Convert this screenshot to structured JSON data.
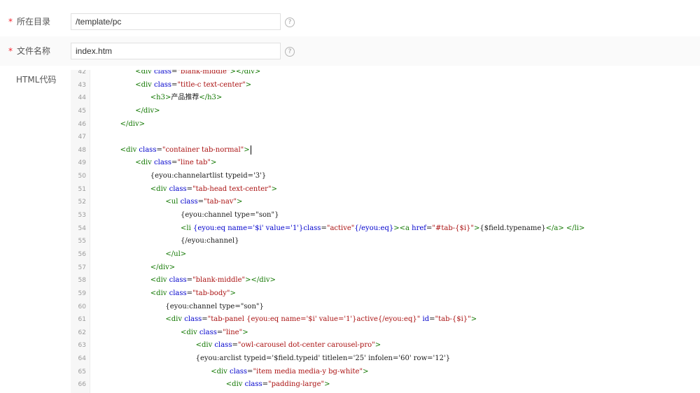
{
  "fields": {
    "directory": {
      "required": "*",
      "label": "所在目录",
      "value": "/template/pc"
    },
    "filename": {
      "required": "*",
      "label": "文件名称",
      "value": "index.htm"
    },
    "html_code": {
      "label": "HTML代码"
    }
  },
  "help_glyph": "?",
  "editor": {
    "lines": [
      {
        "n": "42",
        "indent": 2,
        "parts": [
          [
            "t",
            "<div"
          ],
          [
            "p",
            " "
          ],
          [
            "a",
            "class"
          ],
          [
            "p",
            "="
          ],
          [
            "s",
            "\"blank-middle\""
          ],
          [
            "t",
            "></div>"
          ]
        ]
      },
      {
        "n": "43",
        "indent": 2,
        "parts": [
          [
            "t",
            "<div"
          ],
          [
            "p",
            " "
          ],
          [
            "a",
            "class"
          ],
          [
            "p",
            "="
          ],
          [
            "s",
            "\"title-c text-center\""
          ],
          [
            "t",
            ">"
          ]
        ]
      },
      {
        "n": "44",
        "indent": 3,
        "parts": [
          [
            "t",
            "<h3>"
          ],
          [
            "p",
            "产品推荐"
          ],
          [
            "t",
            "</h3>"
          ]
        ]
      },
      {
        "n": "45",
        "indent": 2,
        "parts": [
          [
            "t",
            "</div>"
          ]
        ]
      },
      {
        "n": "46",
        "indent": 1,
        "parts": [
          [
            "t",
            "</div>"
          ]
        ]
      },
      {
        "n": "47",
        "indent": 0,
        "parts": []
      },
      {
        "n": "48",
        "indent": 1,
        "cursor": true,
        "parts": [
          [
            "t",
            "<div"
          ],
          [
            "p",
            " "
          ],
          [
            "a",
            "class"
          ],
          [
            "p",
            "="
          ],
          [
            "s",
            "\"container tab-normal\""
          ],
          [
            "t",
            ">"
          ]
        ]
      },
      {
        "n": "49",
        "indent": 2,
        "parts": [
          [
            "t",
            "<div"
          ],
          [
            "p",
            " "
          ],
          [
            "a",
            "class"
          ],
          [
            "p",
            "="
          ],
          [
            "s",
            "\"line tab\""
          ],
          [
            "t",
            ">"
          ]
        ]
      },
      {
        "n": "50",
        "indent": 3,
        "parts": [
          [
            "p",
            "{eyou:channelartlist typeid='3'}"
          ]
        ]
      },
      {
        "n": "51",
        "indent": 3,
        "parts": [
          [
            "t",
            "<div"
          ],
          [
            "p",
            " "
          ],
          [
            "a",
            "class"
          ],
          [
            "p",
            "="
          ],
          [
            "s",
            "\"tab-head text-center\""
          ],
          [
            "t",
            ">"
          ]
        ]
      },
      {
        "n": "52",
        "indent": 4,
        "parts": [
          [
            "t",
            "<ul"
          ],
          [
            "p",
            " "
          ],
          [
            "a",
            "class"
          ],
          [
            "p",
            "="
          ],
          [
            "s",
            "\"tab-nav\""
          ],
          [
            "t",
            ">"
          ]
        ]
      },
      {
        "n": "53",
        "indent": 5,
        "parts": [
          [
            "p",
            "{eyou:channel type=\"son\"}"
          ]
        ]
      },
      {
        "n": "54",
        "indent": 5,
        "parts": [
          [
            "t",
            "<li"
          ],
          [
            "p",
            " "
          ],
          [
            "a",
            "{eyou:eq name='$i' value='1'}class"
          ],
          [
            "p",
            "="
          ],
          [
            "s",
            "\"active\""
          ],
          [
            "a",
            "{/eyou:eq}"
          ],
          [
            "t",
            ">"
          ],
          [
            "t",
            "<a"
          ],
          [
            "p",
            " "
          ],
          [
            "a",
            "href"
          ],
          [
            "p",
            "="
          ],
          [
            "s",
            "\"#tab-{$i}\""
          ],
          [
            "t",
            ">"
          ],
          [
            "p",
            "{$field.typename}"
          ],
          [
            "t",
            "</a>"
          ],
          [
            "p",
            " "
          ],
          [
            "t",
            "</li>"
          ]
        ]
      },
      {
        "n": "55",
        "indent": 5,
        "parts": [
          [
            "p",
            "{/eyou:channel}"
          ]
        ]
      },
      {
        "n": "56",
        "indent": 4,
        "parts": [
          [
            "t",
            "</ul>"
          ]
        ]
      },
      {
        "n": "57",
        "indent": 3,
        "parts": [
          [
            "t",
            "</div>"
          ]
        ]
      },
      {
        "n": "58",
        "indent": 3,
        "parts": [
          [
            "t",
            "<div"
          ],
          [
            "p",
            " "
          ],
          [
            "a",
            "class"
          ],
          [
            "p",
            "="
          ],
          [
            "s",
            "\"blank-middle\""
          ],
          [
            "t",
            "></div>"
          ]
        ]
      },
      {
        "n": "59",
        "indent": 3,
        "parts": [
          [
            "t",
            "<div"
          ],
          [
            "p",
            " "
          ],
          [
            "a",
            "class"
          ],
          [
            "p",
            "="
          ],
          [
            "s",
            "\"tab-body\""
          ],
          [
            "t",
            ">"
          ]
        ]
      },
      {
        "n": "60",
        "indent": 4,
        "parts": [
          [
            "p",
            "{eyou:channel type=\"son\"}"
          ]
        ]
      },
      {
        "n": "61",
        "indent": 4,
        "parts": [
          [
            "t",
            "<div"
          ],
          [
            "p",
            " "
          ],
          [
            "a",
            "class"
          ],
          [
            "p",
            "="
          ],
          [
            "s",
            "\"tab-panel {eyou:eq name='$i' value='1'}active{/eyou:eq}\""
          ],
          [
            "p",
            " "
          ],
          [
            "a",
            "id"
          ],
          [
            "p",
            "="
          ],
          [
            "s",
            "\"tab-{$i}\""
          ],
          [
            "t",
            ">"
          ]
        ]
      },
      {
        "n": "62",
        "indent": 5,
        "parts": [
          [
            "t",
            "<div"
          ],
          [
            "p",
            " "
          ],
          [
            "a",
            "class"
          ],
          [
            "p",
            "="
          ],
          [
            "s",
            "\"line\""
          ],
          [
            "t",
            ">"
          ]
        ]
      },
      {
        "n": "63",
        "indent": 6,
        "parts": [
          [
            "t",
            "<div"
          ],
          [
            "p",
            " "
          ],
          [
            "a",
            "class"
          ],
          [
            "p",
            "="
          ],
          [
            "s",
            "\"owl-carousel dot-center carousel-pro\""
          ],
          [
            "t",
            ">"
          ]
        ]
      },
      {
        "n": "64",
        "indent": 6,
        "parts": [
          [
            "p",
            "{eyou:arclist typeid='$field.typeid' titlelen='25' infolen='60' row='12'}"
          ]
        ]
      },
      {
        "n": "65",
        "indent": 7,
        "parts": [
          [
            "t",
            "<div"
          ],
          [
            "p",
            " "
          ],
          [
            "a",
            "class"
          ],
          [
            "p",
            "="
          ],
          [
            "s",
            "\"item media media-y bg-white\""
          ],
          [
            "t",
            ">"
          ]
        ]
      },
      {
        "n": "66",
        "indent": 8,
        "parts": [
          [
            "t",
            "<div"
          ],
          [
            "p",
            " "
          ],
          [
            "a",
            "class"
          ],
          [
            "p",
            "="
          ],
          [
            "s",
            "\"padding-large\""
          ],
          [
            "t",
            ">"
          ]
        ]
      }
    ]
  }
}
